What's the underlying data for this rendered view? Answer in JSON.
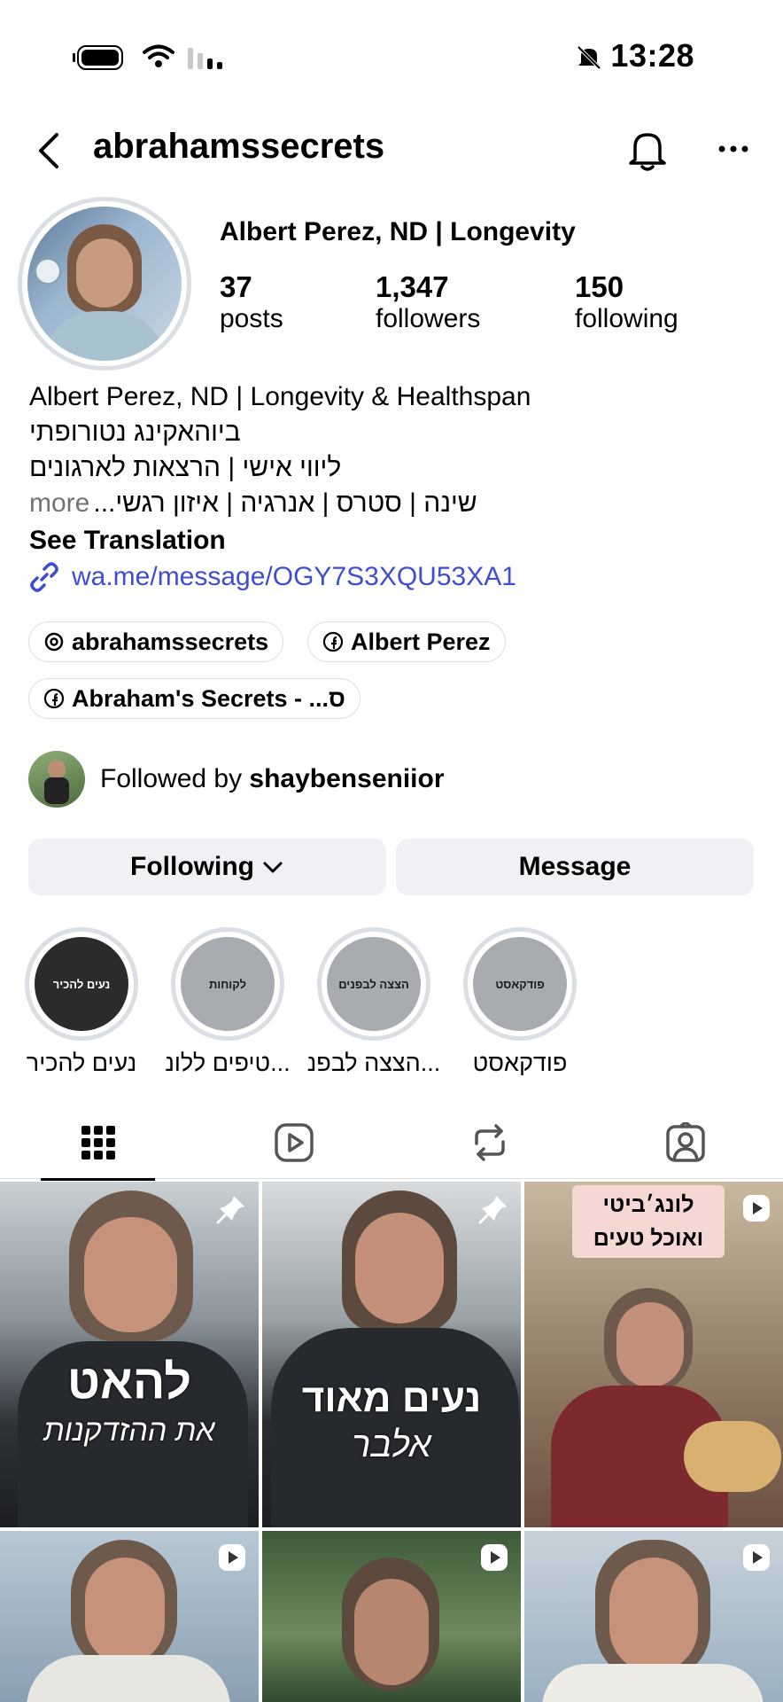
{
  "status_bar": {
    "time": "13:28"
  },
  "header": {
    "username": "abrahamssecrets"
  },
  "profile": {
    "display_name": "Albert Perez, ND | Longevity",
    "stats": [
      {
        "value": "37",
        "label": "posts"
      },
      {
        "value": "1,347",
        "label": "followers"
      },
      {
        "value": "150",
        "label": "following"
      }
    ]
  },
  "bio": {
    "line1": "Albert Perez, ND | Longevity & Healthspan",
    "line2": "ביוהאקינג נטורופתי",
    "line3": "ליווי אישי | הרצאות לארגונים",
    "line4": "שינה | סטרס | אנרגיה | איזון רגשי...",
    "more": "more",
    "see_translation": "See Translation",
    "link": "wa.me/message/OGY7S3XQU53XA1"
  },
  "chips": [
    {
      "label": "abrahamssecrets",
      "icon": "threads-icon"
    },
    {
      "label": "Albert Perez",
      "icon": "facebook-icon"
    },
    {
      "label": "Abraham's Secrets - ...ס",
      "icon": "facebook-icon"
    }
  ],
  "followed_by": {
    "prefix": "Followed by ",
    "user": "shaybenseniior"
  },
  "actions": {
    "following": "Following",
    "message": "Message"
  },
  "highlights": [
    {
      "label": "נעים להכיר",
      "cover": "נעים להכיר",
      "bg": "#2b2b2b",
      "fg": "#ffffff"
    },
    {
      "label": "טיפים ללונ...",
      "cover": "לקוחות",
      "bg": "#a8acb0",
      "fg": "#1a1a1a"
    },
    {
      "label": "הצצה לבפנ...",
      "cover": "הצצה לבפנים",
      "bg": "#a8acb0",
      "fg": "#1a1a1a"
    },
    {
      "label": "פודקאסט",
      "cover": "פודקאסט",
      "bg": "#a8acb0",
      "fg": "#1a1a1a"
    }
  ],
  "tabs": [
    "grid-icon",
    "reels-icon",
    "reposts-icon",
    "tagged-icon"
  ],
  "posts": [
    {
      "overlay": "להאט",
      "overlay2": "את ההזדקנות",
      "badge": "pin-icon"
    },
    {
      "overlay": "נעים מאוד",
      "overlay2": "אלבר",
      "badge": "pin-icon"
    },
    {
      "overlay": "לונג׳ביטי\nואוכל טעים",
      "overlay2": "",
      "badge": "reel-icon"
    },
    {
      "overlay": "",
      "overlay2": "",
      "badge": "reel-icon"
    },
    {
      "overlay": "",
      "overlay2": "",
      "badge": "reel-icon"
    },
    {
      "overlay": "",
      "overlay2": "",
      "badge": "reel-icon"
    }
  ]
}
